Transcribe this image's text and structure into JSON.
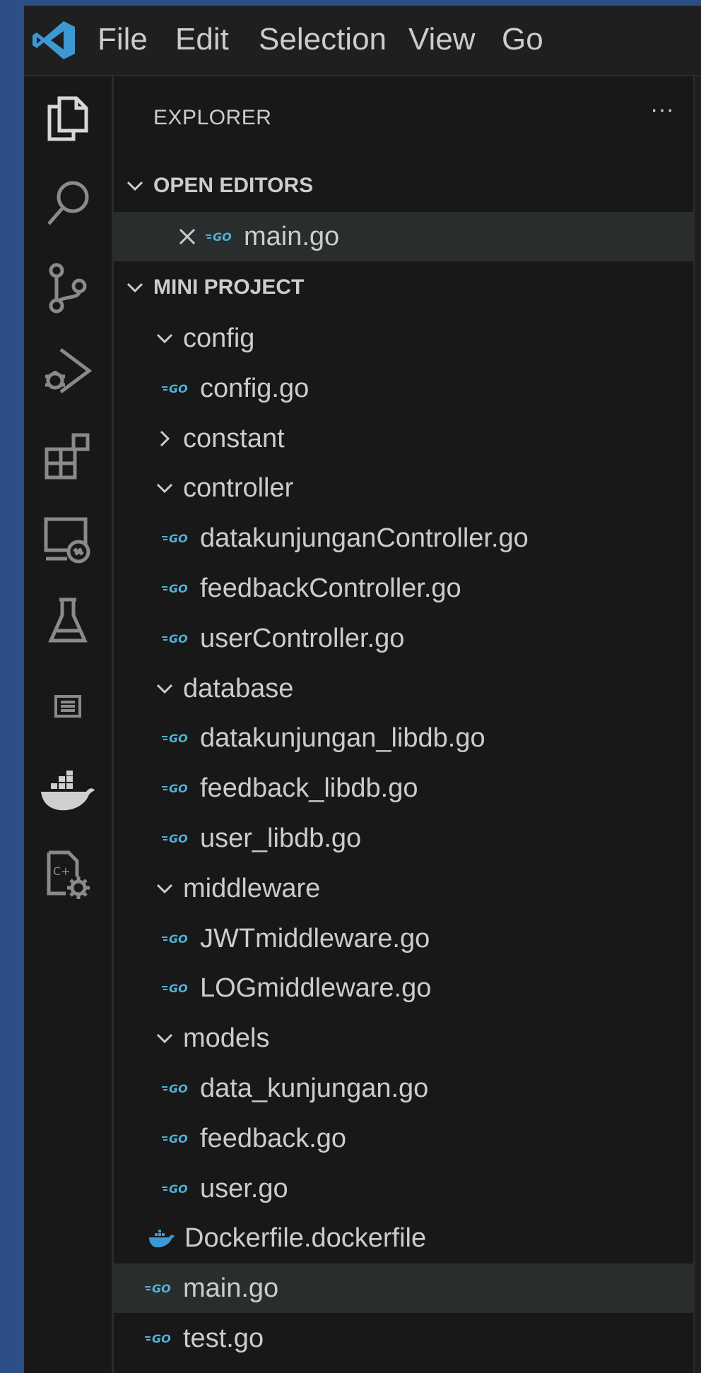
{
  "menu": {
    "file": "File",
    "edit": "Edit",
    "selection": "Selection",
    "view": "View",
    "go": "Go"
  },
  "explorer": {
    "title": "EXPLORER",
    "more": "···"
  },
  "open_editors": {
    "header": "OPEN EDITORS",
    "items": [
      {
        "label": "main.go",
        "icon": "go-file-icon"
      }
    ]
  },
  "project": {
    "header": "MINI PROJECT",
    "items": [
      {
        "label": "config",
        "type": "folder",
        "expanded": true,
        "depth": 1
      },
      {
        "label": "config.go",
        "type": "go",
        "depth": 2
      },
      {
        "label": "constant",
        "type": "folder",
        "expanded": false,
        "depth": 1
      },
      {
        "label": "controller",
        "type": "folder",
        "expanded": true,
        "depth": 1
      },
      {
        "label": "datakunjunganController.go",
        "type": "go",
        "depth": 2
      },
      {
        "label": "feedbackController.go",
        "type": "go",
        "depth": 2
      },
      {
        "label": "userController.go",
        "type": "go",
        "depth": 2
      },
      {
        "label": "database",
        "type": "folder",
        "expanded": true,
        "depth": 1
      },
      {
        "label": "datakunjungan_libdb.go",
        "type": "go",
        "depth": 2
      },
      {
        "label": "feedback_libdb.go",
        "type": "go",
        "depth": 2
      },
      {
        "label": "user_libdb.go",
        "type": "go",
        "depth": 2
      },
      {
        "label": "middleware",
        "type": "folder",
        "expanded": true,
        "depth": 1
      },
      {
        "label": "JWTmiddleware.go",
        "type": "go",
        "depth": 2
      },
      {
        "label": "LOGmiddleware.go",
        "type": "go",
        "depth": 2
      },
      {
        "label": "models",
        "type": "folder",
        "expanded": true,
        "depth": 1
      },
      {
        "label": "data_kunjungan.go",
        "type": "go",
        "depth": 2
      },
      {
        "label": "feedback.go",
        "type": "go",
        "depth": 2
      },
      {
        "label": "user.go",
        "type": "go",
        "depth": 2
      },
      {
        "label": "Dockerfile.dockerfile",
        "type": "docker",
        "depth": 1
      },
      {
        "label": "main.go",
        "type": "go",
        "depth": 1,
        "selected": true
      },
      {
        "label": "test.go",
        "type": "go",
        "depth": 1
      }
    ]
  },
  "colors": {
    "accent_blue": "#3c99d4",
    "go_blue": "#4fb3d9",
    "docker_blue": "#3c99d4",
    "text": "#cccccc",
    "selection": "#2a2d2e"
  }
}
